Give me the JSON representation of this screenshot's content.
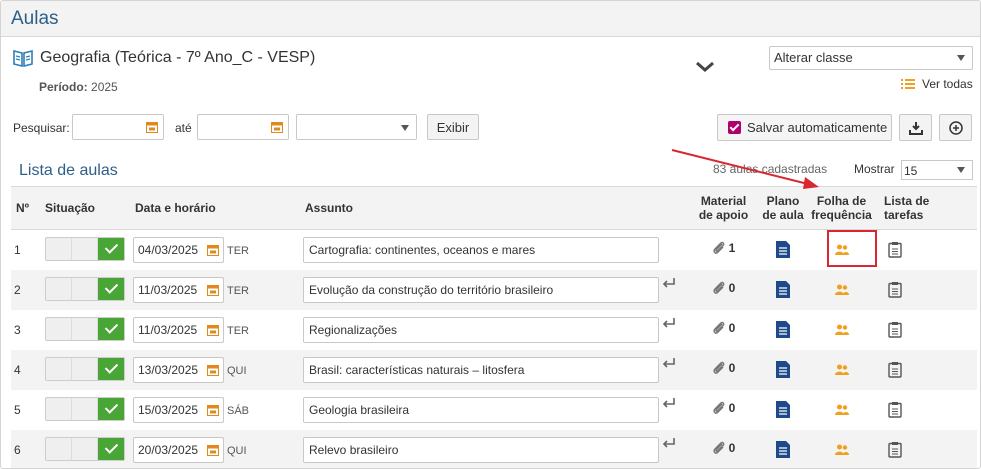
{
  "page": {
    "title": "Aulas"
  },
  "class_info": {
    "name": "Geografia (Teórica - 7º Ano_C - VESP)",
    "periodo_label": "Período:",
    "periodo_value": "2025"
  },
  "alterar_classe": {
    "selected": "Alterar classe"
  },
  "ver_todas": "Ver todas",
  "filters": {
    "pesquisar_label": "Pesquisar:",
    "ate_label": "até",
    "date_from": "",
    "date_to": "",
    "status_selected": "",
    "exibir_label": "Exibir"
  },
  "toolbar": {
    "salvar_label": "Salvar automaticamente",
    "salvar_checked": true
  },
  "list": {
    "title": "Lista de aulas",
    "count_text": "83 aulas cadastradas",
    "mostrar_label": "Mostrar",
    "mostrar_value": "15"
  },
  "table": {
    "headers": {
      "num": "Nº",
      "situacao": "Situação",
      "data": "Data e horário",
      "assunto": "Assunto",
      "material_1": "Material",
      "material_2": "de apoio",
      "plano_1": "Plano",
      "plano_2": "de aula",
      "folha_1": "Folha de",
      "folha_2": "frequência",
      "lista_1": "Lista de",
      "lista_2": "tarefas"
    },
    "rows": [
      {
        "num": "1",
        "date": "04/03/2025",
        "dow": "TER",
        "assunto": "Cartografia: continentes, oceanos e mares",
        "material": "1"
      },
      {
        "num": "2",
        "date": "11/03/2025",
        "dow": "TER",
        "assunto": "Evolução da construção do território brasileiro",
        "material": "0"
      },
      {
        "num": "3",
        "date": "11/03/2025",
        "dow": "TER",
        "assunto": "Regionalizações",
        "material": "0"
      },
      {
        "num": "4",
        "date": "13/03/2025",
        "dow": "QUI",
        "assunto": "Brasil: características naturais – litosfera",
        "material": "0"
      },
      {
        "num": "5",
        "date": "15/03/2025",
        "dow": "SÁB",
        "assunto": "Geologia brasileira",
        "material": "0"
      },
      {
        "num": "6",
        "date": "20/03/2025",
        "dow": "QUI",
        "assunto": "Relevo brasileiro",
        "material": "0"
      }
    ]
  },
  "colors": {
    "accent": "#2d5f8a",
    "success": "#4aa537",
    "checkbox": "#b0006e",
    "orange": "#f0a020",
    "doc_blue": "#1f4a8a",
    "annotation_red": "#d9272f"
  }
}
